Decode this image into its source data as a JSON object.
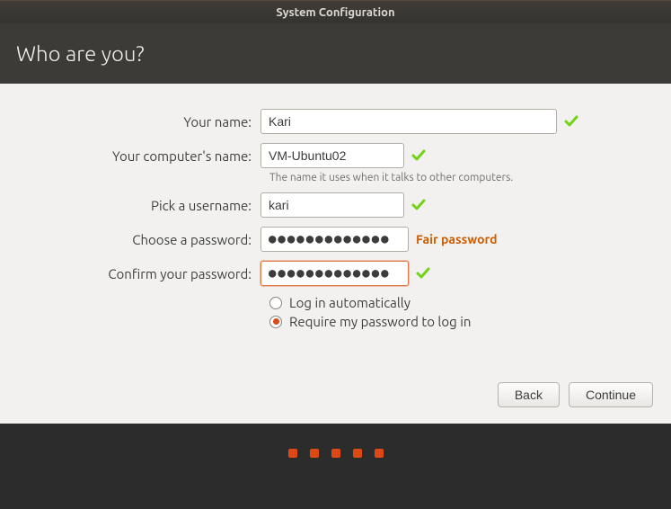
{
  "window": {
    "title": "System Configuration"
  },
  "header": {
    "title": "Who are you?"
  },
  "form": {
    "name": {
      "label": "Your name:",
      "value": "Kari"
    },
    "computer": {
      "label": "Your computer's name:",
      "value": "VM-Ubuntu02",
      "hint": "The name it uses when it talks to other computers."
    },
    "username": {
      "label": "Pick a username:",
      "value": "kari"
    },
    "password": {
      "label": "Choose a password:",
      "value": "●●●●●●●●●●●●●",
      "strength": "Fair password"
    },
    "confirm": {
      "label": "Confirm your password:",
      "value": "●●●●●●●●●●●●●"
    },
    "login_options": {
      "auto": "Log in automatically",
      "require": "Require my password to log in",
      "selected": "require"
    }
  },
  "buttons": {
    "back": "Back",
    "continue": "Continue"
  },
  "colors": {
    "accent": "#dd4814",
    "check": "#73d216",
    "strength": "#ce5c00"
  }
}
